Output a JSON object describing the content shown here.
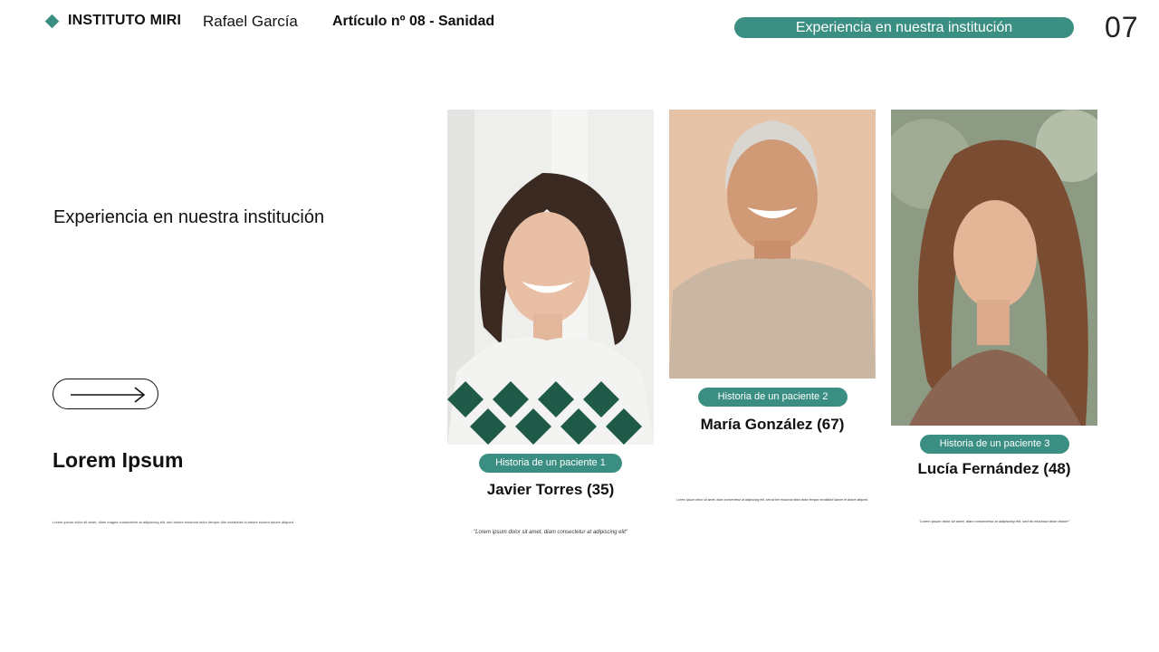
{
  "header": {
    "brand": "INSTITUTO MIRI",
    "author": "Rafael García",
    "article": "Artículo nº 08 - Sanidad",
    "pill": "Experiencia en nuestra institución",
    "page_number": "07"
  },
  "left": {
    "title": "Experiencia en nuestra institución",
    "heading": "Lorem Ipsum",
    "body": "Lorem ipsum dolor sit amet, diam magna consectetur at adipiscing elit, sed dolore eiusmod dolor tempor dim incididunt ut labore eiusmt dolore aliqued."
  },
  "patients": [
    {
      "label": "Historia de un paciente 1",
      "name": "Javier Torres (35)",
      "quote": "\"Lorem ipsum dolor sit amet, diam consectetur at adipiscing elit\""
    },
    {
      "label": "Historia de un paciente 2",
      "name": "María González (67)",
      "quote": "Lorem ipsum dolor sit amet, diam consectetur at adipiscing elit, sed at the eiusmod diam dolor tempor incididunt labore et dolore aliqued."
    },
    {
      "label": "Historia de un paciente 3",
      "name": "Lucía Fernández (48)",
      "quote": "\"Lorem ipsum dolor sit amet, diam consectetur at adipiscing elit, sed do eiusmod dolor dolore\""
    }
  ],
  "colors": {
    "accent": "#3a8f82"
  },
  "icons": {
    "brand": "diamond-icon",
    "arrow": "arrow-right-icon"
  }
}
